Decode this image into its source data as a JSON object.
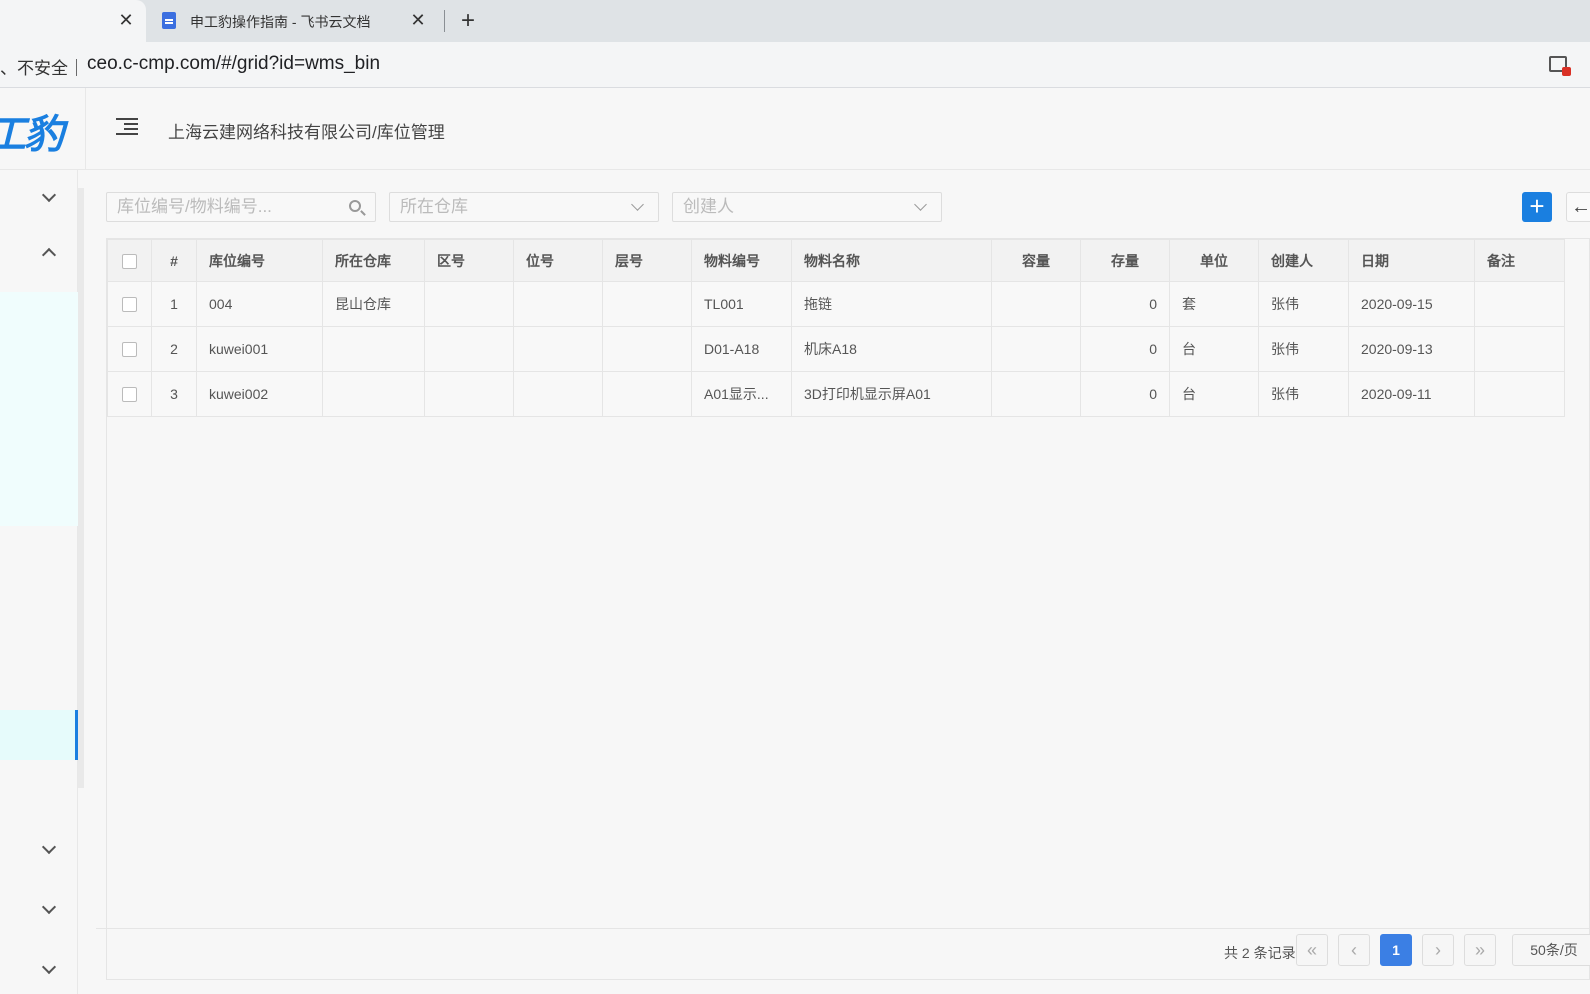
{
  "browser": {
    "tabs": [
      {
        "title": ""
      },
      {
        "title": "申工豹操作指南 - 飞书云文档"
      }
    ],
    "address": {
      "security_label": "、不安全｜",
      "url": "ceo.c-cmp.com/#/grid?id=wms_bin"
    }
  },
  "app": {
    "logo_text": "工豹",
    "breadcrumb": "上海云建网络科技有限公司/库位管理"
  },
  "toolbar": {
    "search_placeholder": "库位编号/物料编号...",
    "warehouse_placeholder": "所在仓库",
    "creator_placeholder": "创建人",
    "add_label": "+",
    "back_label": "←"
  },
  "table": {
    "columns": [
      "#",
      "库位编号",
      "所在仓库",
      "区号",
      "位号",
      "层号",
      "物料编号",
      "物料名称",
      "容量",
      "存量",
      "单位",
      "创建人",
      "日期",
      "备注"
    ],
    "rows": [
      {
        "no": "1",
        "bin_code": "004",
        "warehouse": "昆山仓库",
        "zone": "",
        "position": "",
        "layer": "",
        "material_code": "TL001",
        "material_name": "拖链",
        "capacity": "",
        "stock": "0",
        "unit": "套",
        "creator": "张伟",
        "date": "2020-09-15",
        "remark": ""
      },
      {
        "no": "2",
        "bin_code": "kuwei001",
        "warehouse": "",
        "zone": "",
        "position": "",
        "layer": "",
        "material_code": "D01-A18",
        "material_name": "机床A18",
        "capacity": "",
        "stock": "0",
        "unit": "台",
        "creator": "张伟",
        "date": "2020-09-13",
        "remark": ""
      },
      {
        "no": "3",
        "bin_code": "kuwei002",
        "warehouse": "",
        "zone": "",
        "position": "",
        "layer": "",
        "material_code": "A01显示...",
        "material_name": "3D打印机显示屏A01",
        "capacity": "",
        "stock": "0",
        "unit": "台",
        "creator": "张伟",
        "date": "2020-09-11",
        "remark": ""
      }
    ]
  },
  "pagination": {
    "total_text": "共 2 条记录",
    "first": "«",
    "prev": "‹",
    "current_page": "1",
    "next": "›",
    "last": "»",
    "page_size": "50条/页"
  }
}
